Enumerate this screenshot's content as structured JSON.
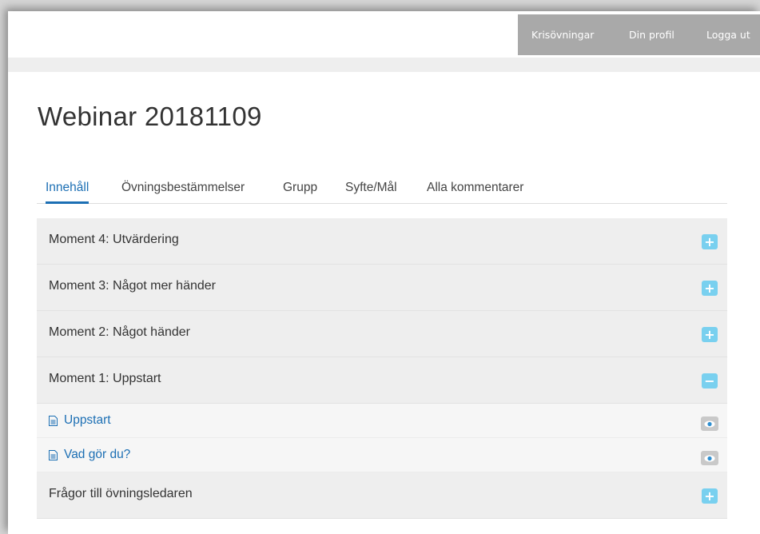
{
  "nav": {
    "links": [
      "Krisövningar",
      "Din profil",
      "Logga ut"
    ]
  },
  "page": {
    "title": "Webinar 20181109"
  },
  "tabs": [
    {
      "label": "Innehåll",
      "active": true
    },
    {
      "label": "Övningsbestämmelser",
      "active": false
    },
    {
      "label": "Grupp",
      "active": false
    },
    {
      "label": "Syfte/Mål",
      "active": false
    },
    {
      "label": "Alla kommentarer",
      "active": false
    }
  ],
  "panels": [
    {
      "label": "Moment 4: Utvärdering",
      "expanded": false,
      "toggle": "+",
      "icon": "plus-icon"
    },
    {
      "label": "Moment 3: Något mer händer",
      "expanded": false,
      "toggle": "+",
      "icon": "plus-icon"
    },
    {
      "label": "Moment 2: Något händer",
      "expanded": false,
      "toggle": "+",
      "icon": "plus-icon"
    },
    {
      "label": "Moment 1: Uppstart",
      "expanded": true,
      "toggle": "−",
      "icon": "minus-icon",
      "items": [
        {
          "label": "Uppstart",
          "icon": "document-icon",
          "action_icon": "eye-icon"
        },
        {
          "label": "Vad gör du?",
          "icon": "document-icon",
          "action_icon": "eye-icon"
        }
      ]
    },
    {
      "label": "Frågor till övningsledaren",
      "expanded": false,
      "toggle": "+",
      "icon": "plus-icon"
    }
  ],
  "colors": {
    "accent": "#1c6fb4",
    "toggle": "#79d0ef",
    "nav_background": "#a9a9a9",
    "panel_background": "#eeeeee"
  }
}
